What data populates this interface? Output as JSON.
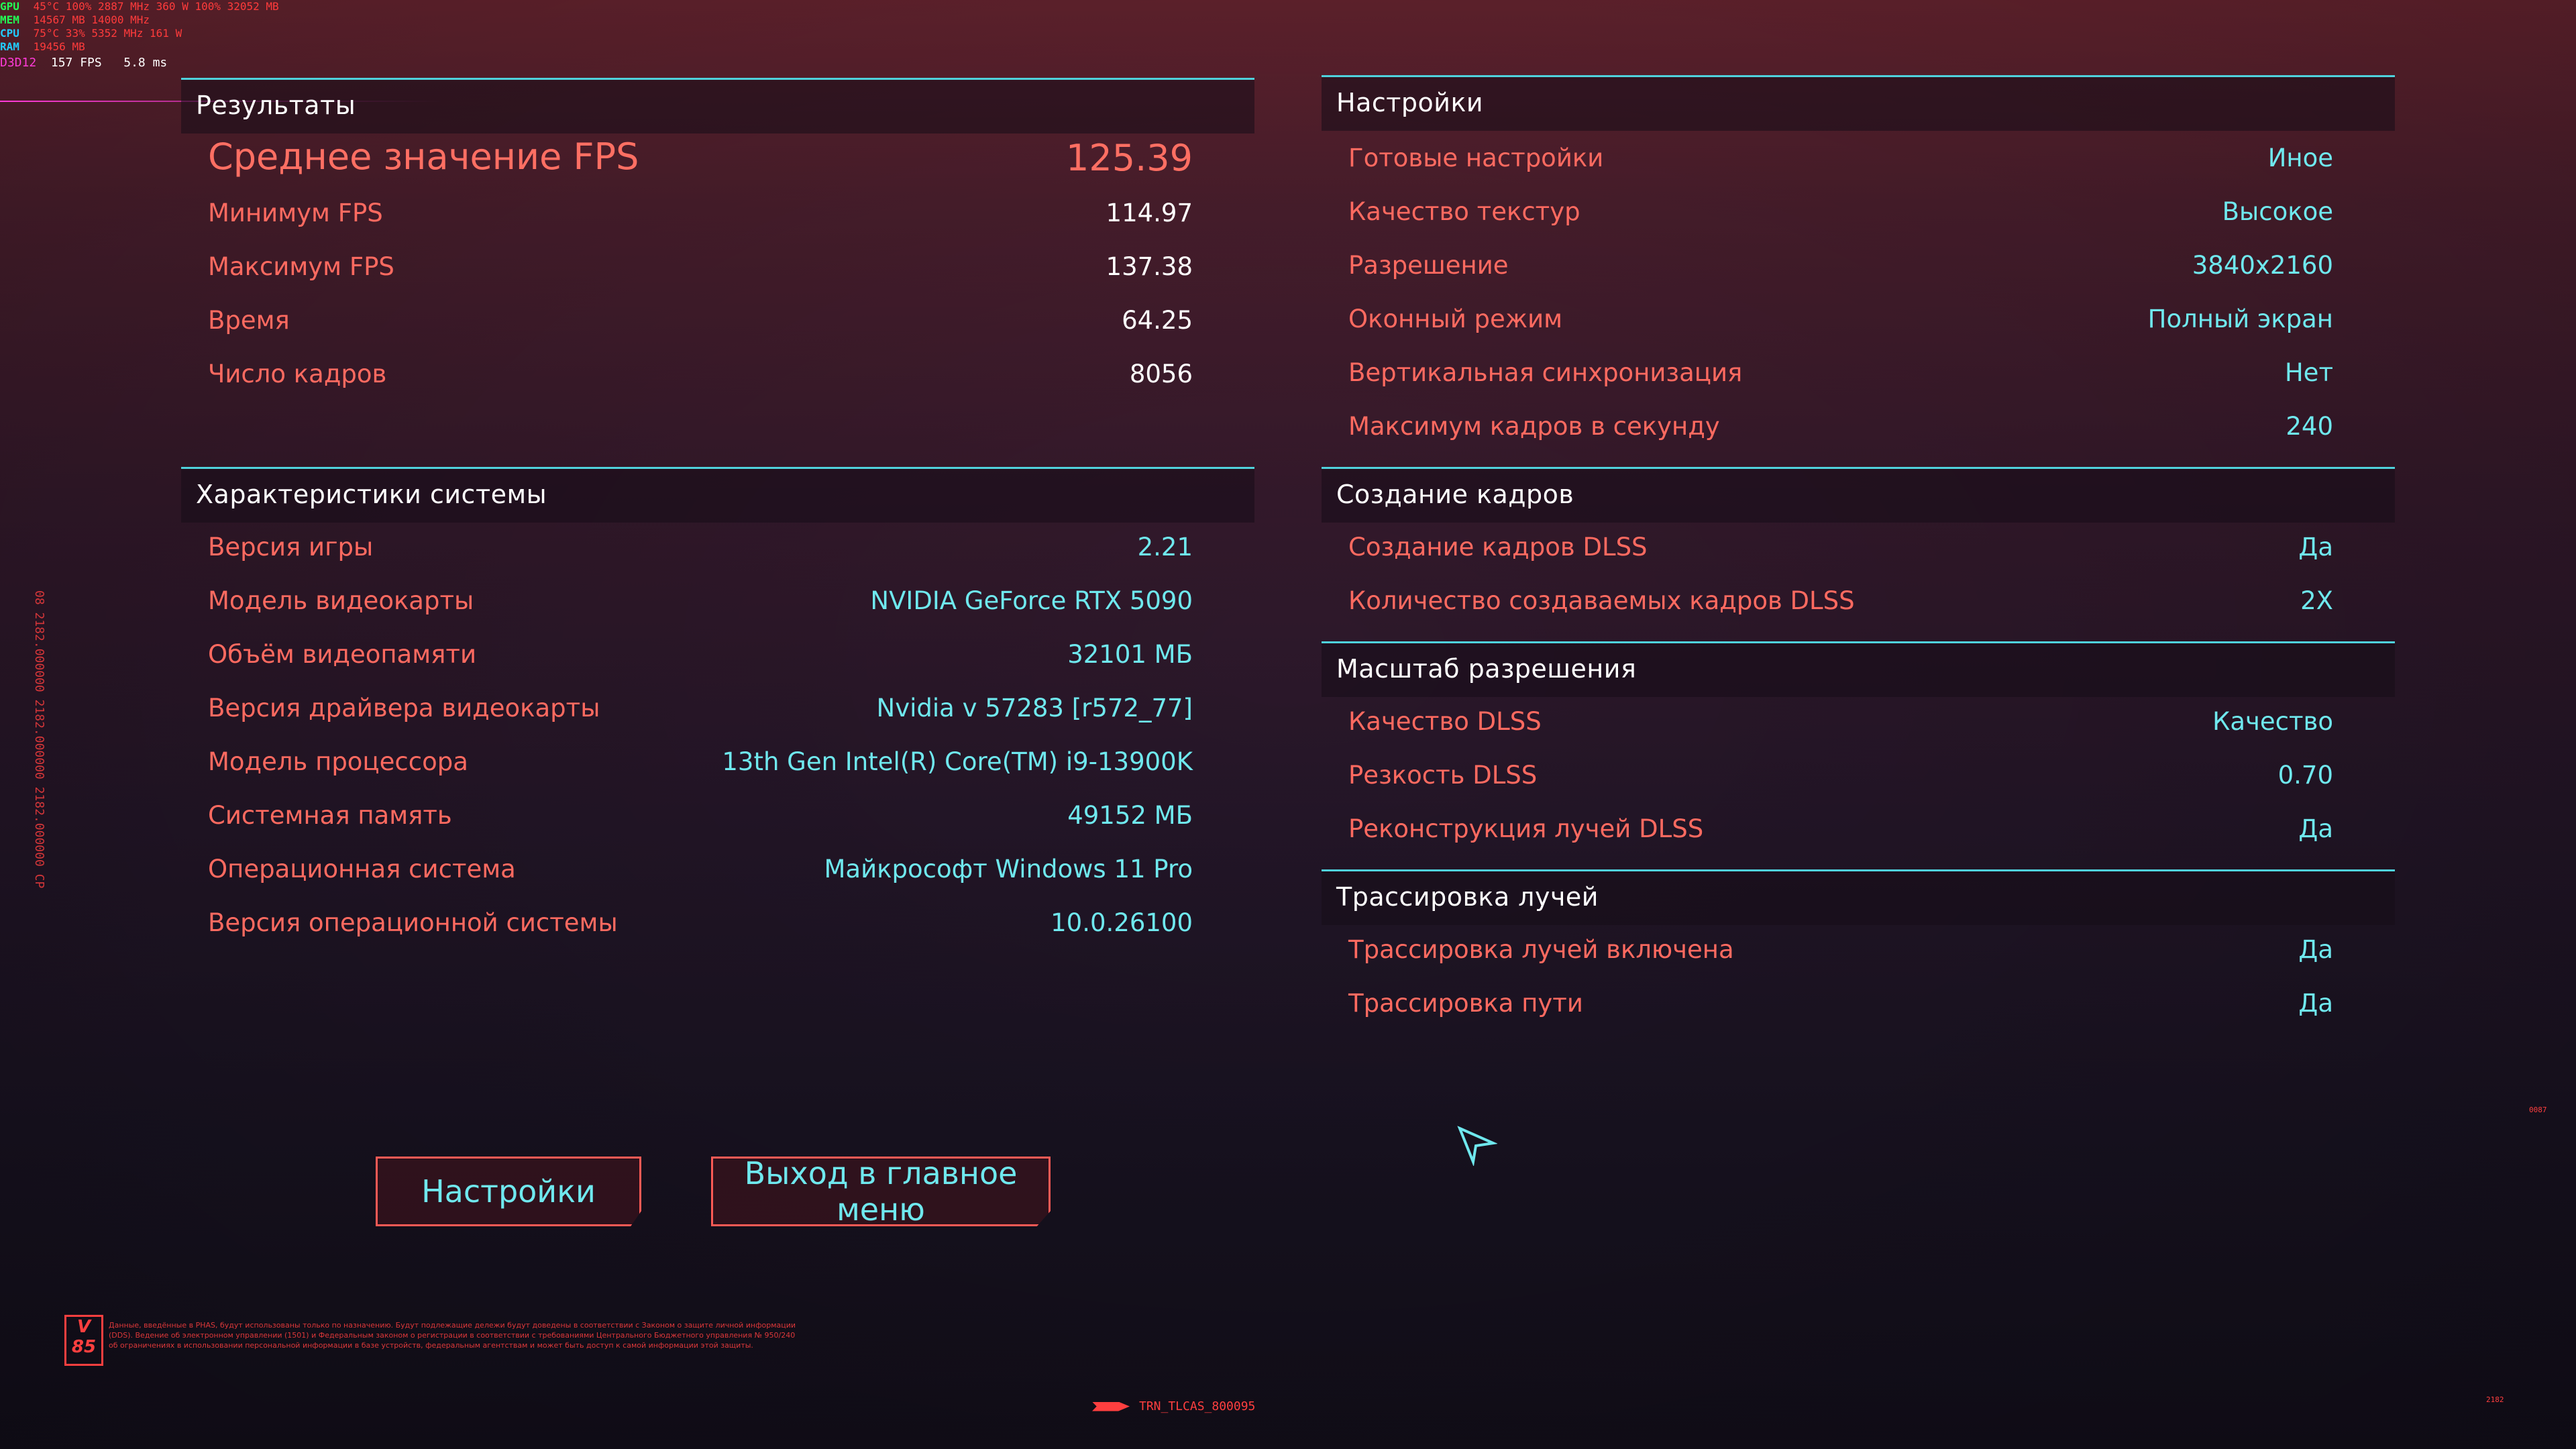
{
  "overlay": {
    "rows": [
      {
        "label": "GPU",
        "values": "45°C  100%  2887 MHz  360 W  100%  32052 MB",
        "color": "#22ff55"
      },
      {
        "label": "MEM",
        "values": "14567 MB  14000 MHz",
        "color": "#22ff55"
      },
      {
        "label": "CPU",
        "values": "75°C  33%  5352 MHz  161 W",
        "color": "#22ccff"
      },
      {
        "label": "RAM",
        "values": "19456 MB",
        "color": "#22ccff"
      }
    ],
    "fps_label": "D3D12",
    "fps_value": "157 FPS",
    "frametime": "5.8 ms"
  },
  "results": {
    "title": "Результаты",
    "rows": [
      {
        "label": "Среднее значение FPS",
        "value": "125.39"
      },
      {
        "label": "Минимум FPS",
        "value": "114.97"
      },
      {
        "label": "Максимум FPS",
        "value": "137.38"
      },
      {
        "label": "Время",
        "value": "64.25"
      },
      {
        "label": "Число кадров",
        "value": "8056"
      }
    ]
  },
  "system": {
    "title": "Характеристики системы",
    "rows": [
      {
        "label": "Версия игры",
        "value": "2.21"
      },
      {
        "label": "Модель видеокарты",
        "value": "NVIDIA GeForce RTX 5090"
      },
      {
        "label": "Объём видеопамяти",
        "value": "32101 МБ"
      },
      {
        "label": "Версия драйвера видеокарты",
        "value": "Nvidia v 57283 [r572_77]"
      },
      {
        "label": "Модель процессора",
        "value": "13th Gen Intel(R) Core(TM) i9-13900K"
      },
      {
        "label": "Системная память",
        "value": "49152 МБ"
      },
      {
        "label": "Операционная система",
        "value": "Майкрософт Windows 11 Pro"
      },
      {
        "label": "Версия операционной системы",
        "value": "10.0.26100"
      }
    ]
  },
  "settings": {
    "title": "Настройки",
    "rows": [
      {
        "label": "Готовые настройки",
        "value": "Иное"
      },
      {
        "label": "Качество текстур",
        "value": "Высокое"
      },
      {
        "label": "Разрешение",
        "value": "3840x2160"
      },
      {
        "label": "Оконный режим",
        "value": "Полный экран"
      },
      {
        "label": "Вертикальная синхронизация",
        "value": "Нет"
      },
      {
        "label": "Максимум кадров в секунду",
        "value": "240"
      }
    ]
  },
  "framegen": {
    "title": "Создание кадров",
    "rows": [
      {
        "label": "Создание кадров DLSS",
        "value": "Да"
      },
      {
        "label": "Количество создаваемых кадров DLSS",
        "value": "2X"
      }
    ]
  },
  "scaling": {
    "title": "Масштаб разрешения",
    "rows": [
      {
        "label": "Качество DLSS",
        "value": "Качество"
      },
      {
        "label": "Резкость DLSS",
        "value": "0.70"
      },
      {
        "label": "Реконструкция лучей DLSS",
        "value": "Да"
      }
    ]
  },
  "raytracing": {
    "title": "Трассировка лучей",
    "rows": [
      {
        "label": "Трассировка лучей включена",
        "value": "Да"
      },
      {
        "label": "Трассировка пути",
        "value": "Да"
      }
    ]
  },
  "buttons": {
    "settings": "Настройки",
    "main_menu": "Выход в главное меню"
  },
  "side_text": "08 2182.000000 2182.000000 2182.000000 CP",
  "legal": {
    "badge_top": "V",
    "badge_bottom": "85",
    "text": "Данные, введённые в PHAS, будут использованы только по назначению. Будут подлежащие дележи будут доведены в соответствии с Законом о защите личной информации (DDS). Ведение об электронном управлении (1501) и Федеральным законом о регистрации в соответствии с требованиями Центрального Бюджетного управления № 950/240 об ограничениях в использовании персональной информации в базе устройств, федеральным агентствам и может быть доступ к самой информации этой защиты."
  },
  "build": "TRN_TLCAS_800095",
  "corner_mid": "0087",
  "corner_bottom": "2182",
  "colors": {
    "label": "#ff6a60",
    "value": "#6fe8ee",
    "accent_line": "#4fd2dc",
    "button_border": "#ff5a55"
  },
  "icons": {
    "cursor": "pointer-arrow-icon"
  }
}
